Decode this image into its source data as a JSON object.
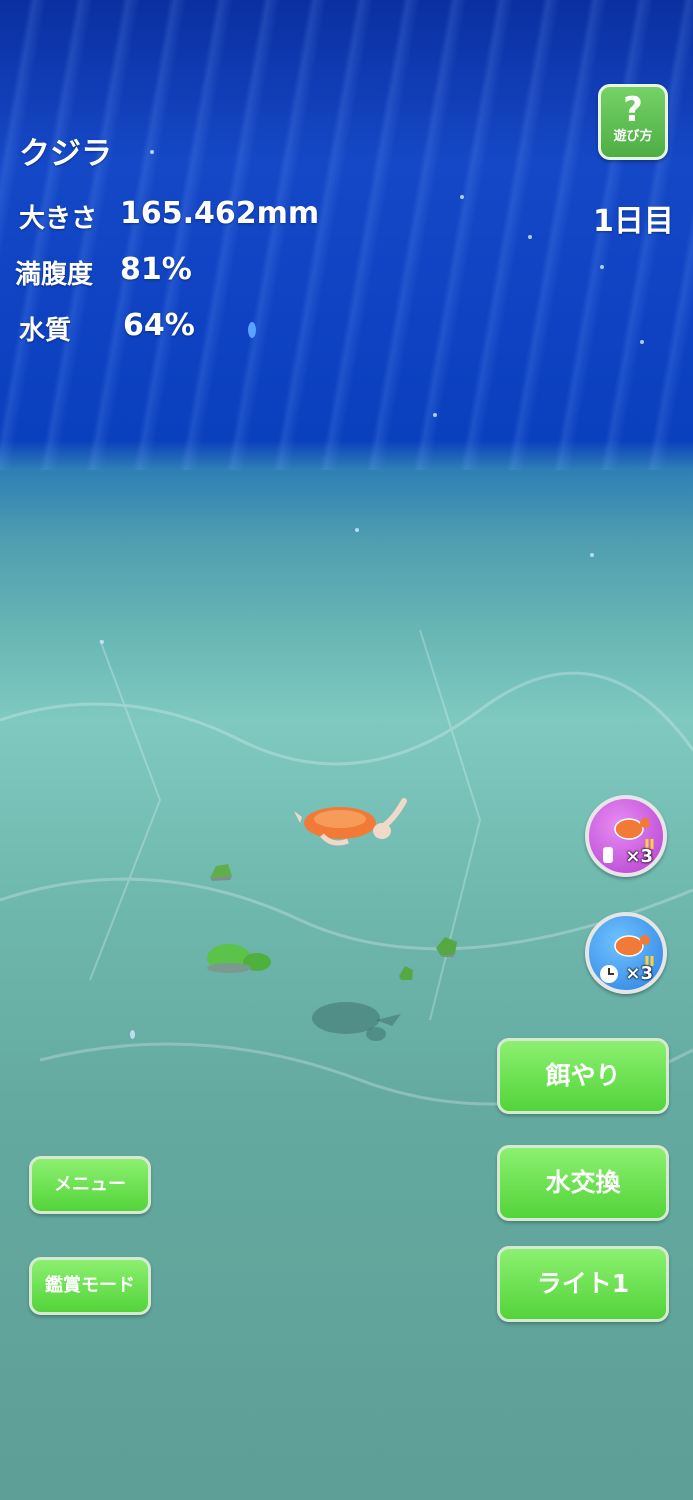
{
  "creature": {
    "name": "クジラ"
  },
  "stats": {
    "size_label": "大きさ",
    "size_value": "165.462mm",
    "fullness_label": "満腹度",
    "fullness_value": "81%",
    "water_label": "水質",
    "water_value": "64%"
  },
  "day": "1日目",
  "help_button": {
    "symbol": "?",
    "caption": "遊び方"
  },
  "boosts": {
    "tap_boost": {
      "icon": "turtle-tap-boost-icon",
      "multiplier": "×3"
    },
    "time_boost": {
      "icon": "turtle-time-boost-icon",
      "multiplier": "×3"
    }
  },
  "actions": {
    "feed": "餌やり",
    "water_change": "水交換",
    "light": "ライト1"
  },
  "menu": {
    "menu_label": "メニュー",
    "viewing_mode_label": "鑑賞モード"
  },
  "colors": {
    "button_green": "#53d43a",
    "water_deep": "#0b2fa0",
    "water_floor": "#6fb8ae",
    "turtle_shell": "#f07a36"
  }
}
